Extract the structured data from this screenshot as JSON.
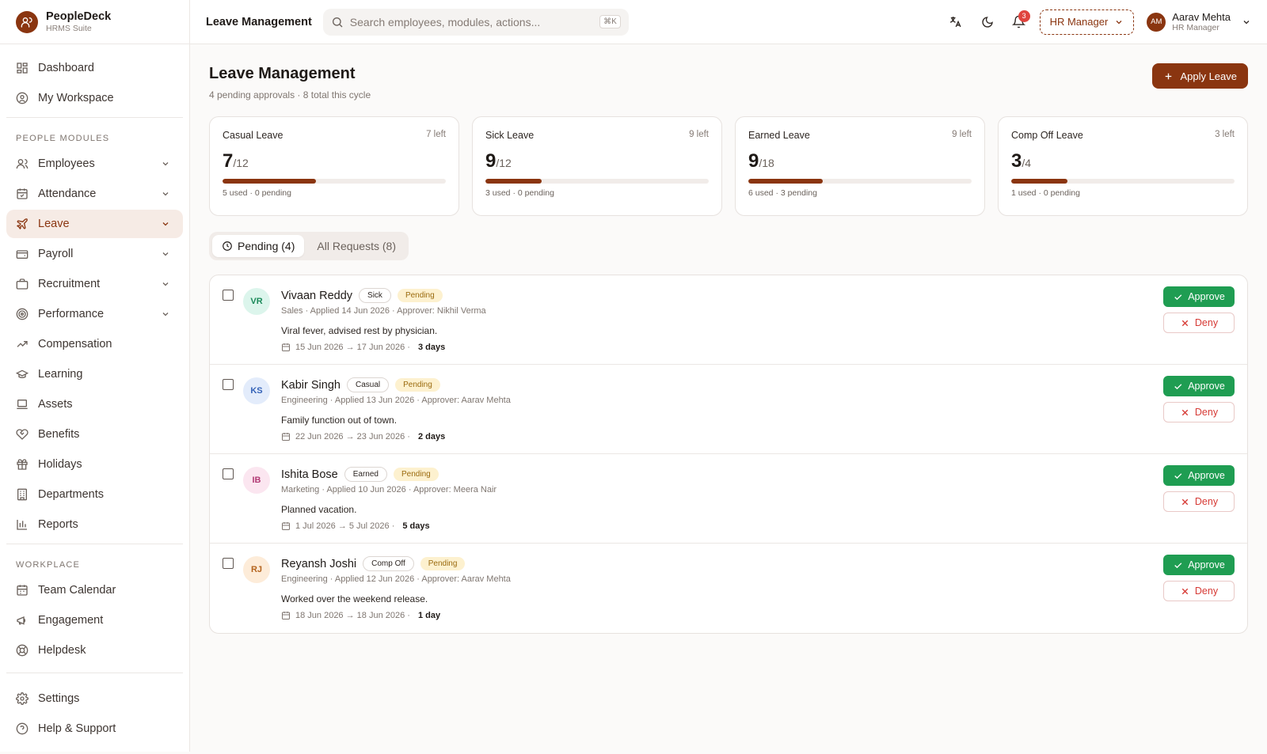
{
  "brand": {
    "name": "PeopleDeck",
    "sub": "HRMS Suite"
  },
  "sidebar": {
    "top": [
      {
        "label": "Dashboard",
        "icon": "dashboard-icon"
      },
      {
        "label": "My Workspace",
        "icon": "user-circle-icon"
      }
    ],
    "people_label": "PEOPLE MODULES",
    "people": [
      {
        "label": "Employees",
        "icon": "users-icon",
        "chevron": true
      },
      {
        "label": "Attendance",
        "icon": "calendar-check-icon",
        "chevron": true
      },
      {
        "label": "Leave",
        "icon": "plane-icon",
        "chevron": true,
        "active": true
      },
      {
        "label": "Payroll",
        "icon": "wallet-icon",
        "chevron": true
      },
      {
        "label": "Recruitment",
        "icon": "briefcase-icon",
        "chevron": true
      },
      {
        "label": "Performance",
        "icon": "target-icon",
        "chevron": true
      },
      {
        "label": "Compensation",
        "icon": "trending-up-icon"
      },
      {
        "label": "Learning",
        "icon": "graduation-cap-icon"
      },
      {
        "label": "Assets",
        "icon": "laptop-icon"
      },
      {
        "label": "Benefits",
        "icon": "heart-handshake-icon"
      },
      {
        "label": "Holidays",
        "icon": "gift-icon"
      },
      {
        "label": "Departments",
        "icon": "building-icon"
      },
      {
        "label": "Reports",
        "icon": "bar-chart-icon"
      }
    ],
    "workplace_label": "WORKPLACE",
    "workplace": [
      {
        "label": "Team Calendar",
        "icon": "calendar-icon"
      },
      {
        "label": "Engagement",
        "icon": "megaphone-icon"
      },
      {
        "label": "Helpdesk",
        "icon": "lifebuoy-icon"
      }
    ],
    "bottom": [
      {
        "label": "Settings",
        "icon": "gear-icon"
      },
      {
        "label": "Help & Support",
        "icon": "help-circle-icon"
      }
    ]
  },
  "topbar": {
    "title": "Leave Management",
    "search_placeholder": "Search employees, modules, actions...",
    "shortcut": "⌘K",
    "notifications": "3",
    "role": "HR Manager",
    "user": {
      "initials": "AM",
      "name": "Aarav Mehta",
      "role": "HR Manager"
    }
  },
  "page": {
    "title": "Leave Management",
    "subtitle": "4 pending approvals · 8 total this cycle",
    "apply_label": "Apply Leave"
  },
  "balances": [
    {
      "name": "Casual Leave",
      "left": "7 left",
      "value": "7",
      "total": "/12",
      "used_fraction": 0.4167,
      "foot": "5 used · 0 pending"
    },
    {
      "name": "Sick Leave",
      "left": "9 left",
      "value": "9",
      "total": "/12",
      "used_fraction": 0.25,
      "foot": "3 used · 0 pending"
    },
    {
      "name": "Earned Leave",
      "left": "9 left",
      "value": "9",
      "total": "/18",
      "used_fraction": 0.3333,
      "foot": "6 used · 3 pending"
    },
    {
      "name": "Comp Off Leave",
      "left": "3 left",
      "value": "3",
      "total": "/4",
      "used_fraction": 0.25,
      "foot": "1 used · 0 pending"
    }
  ],
  "tabs": {
    "pending": "Pending (4)",
    "all": "All Requests (8)"
  },
  "requests": [
    {
      "initials": "VR",
      "name": "Vivaan Reddy",
      "type": "Sick",
      "status": "Pending",
      "meta": "Sales · Applied 14 Jun 2026 · Approver: Nikhil Verma",
      "reason": "Viral fever, advised rest by physician.",
      "range": "15 Jun 2026 → 17 Jun 2026 ·",
      "days": "3 days",
      "av_bg": "#dcf5ec",
      "av_fg": "#1b8a5a"
    },
    {
      "initials": "KS",
      "name": "Kabir Singh",
      "type": "Casual",
      "status": "Pending",
      "meta": "Engineering · Applied 13 Jun 2026 · Approver: Aarav Mehta",
      "reason": "Family function out of town.",
      "range": "22 Jun 2026 → 23 Jun 2026 ·",
      "days": "2 days",
      "av_bg": "#e3ecfb",
      "av_fg": "#3563b8"
    },
    {
      "initials": "IB",
      "name": "Ishita Bose",
      "type": "Earned",
      "status": "Pending",
      "meta": "Marketing · Applied 10 Jun 2026 · Approver: Meera Nair",
      "reason": "Planned vacation.",
      "range": "1 Jul 2026 → 5 Jul 2026 ·",
      "days": "5 days",
      "av_bg": "#fbe6f0",
      "av_fg": "#b23a75"
    },
    {
      "initials": "RJ",
      "name": "Reyansh Joshi",
      "type": "Comp Off",
      "status": "Pending",
      "meta": "Engineering · Applied 12 Jun 2026 · Approver: Aarav Mehta",
      "reason": "Worked over the weekend release.",
      "range": "18 Jun 2026 → 18 Jun 2026 ·",
      "days": "1 day",
      "av_bg": "#fdecd9",
      "av_fg": "#b4631d"
    }
  ],
  "actions": {
    "approve": "Approve",
    "deny": "Deny"
  },
  "colors": {
    "accent": "#8a3510",
    "approve": "#1f9d52",
    "deny": "#d63a35",
    "pending_bg": "#fdf1cf"
  }
}
